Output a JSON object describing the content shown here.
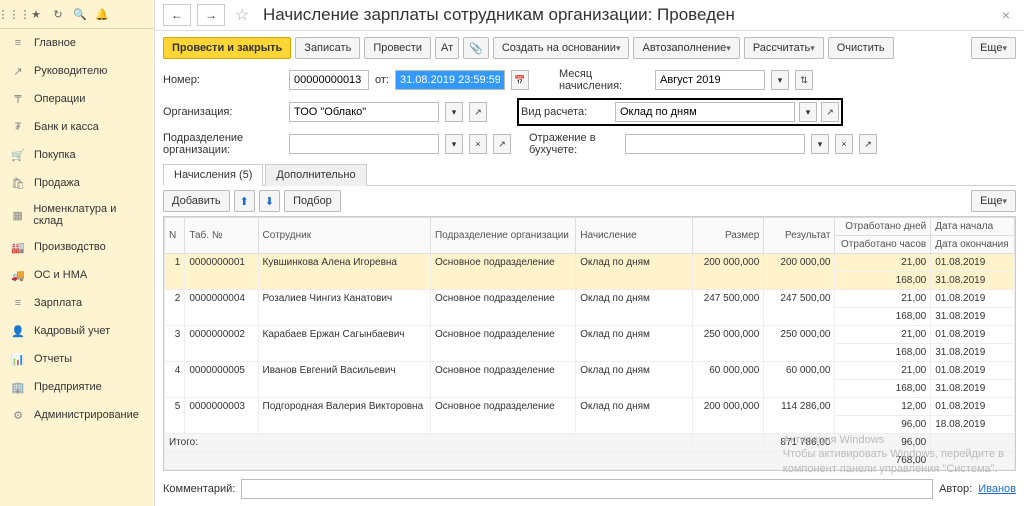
{
  "sidebar": {
    "items": [
      {
        "icon": "≡",
        "label": "Главное"
      },
      {
        "icon": "↗",
        "label": "Руководителю"
      },
      {
        "icon": "₸",
        "label": "Операции"
      },
      {
        "icon": "₮",
        "label": "Банк и касса"
      },
      {
        "icon": "🛒",
        "label": "Покупка"
      },
      {
        "icon": "🛍",
        "label": "Продажа"
      },
      {
        "icon": "▦",
        "label": "Номенклатура и склад"
      },
      {
        "icon": "🏭",
        "label": "Производство"
      },
      {
        "icon": "🚚",
        "label": "ОС и НМА"
      },
      {
        "icon": "≡",
        "label": "Зарплата"
      },
      {
        "icon": "👤",
        "label": "Кадровый учет"
      },
      {
        "icon": "📊",
        "label": "Отчеты"
      },
      {
        "icon": "🏢",
        "label": "Предприятие"
      },
      {
        "icon": "⚙",
        "label": "Администрирование"
      }
    ]
  },
  "header": {
    "title": "Начисление зарплаты сотрудникам организации: Проведен"
  },
  "toolbar": {
    "post_close": "Провести и закрыть",
    "write": "Записать",
    "post": "Провести",
    "create_based": "Создать на основании",
    "autofill": "Автозаполнение",
    "calc": "Рассчитать",
    "clear": "Очистить",
    "more": "Еще"
  },
  "form": {
    "number_lbl": "Номер:",
    "number": "00000000013",
    "from_lbl": "от:",
    "date": "31.08.2019 23:59:59",
    "month_lbl": "Месяц начисления:",
    "month": "Август 2019",
    "org_lbl": "Организация:",
    "org": "ТОО \"Облако\"",
    "calc_type_lbl": "Вид расчета:",
    "calc_type": "Оклад по дням",
    "dept_lbl": "Подразделение организации:",
    "dept": "",
    "acc_lbl": "Отражение в бухучете:",
    "acc": ""
  },
  "tabs": {
    "t1": "Начисления (5)",
    "t2": "Дополнительно"
  },
  "tbl_bar": {
    "add": "Добавить",
    "pick": "Подбор",
    "more": "Еще"
  },
  "cols": {
    "n": "N",
    "tab": "Таб. №",
    "emp": "Сотрудник",
    "dept": "Подразделение организации",
    "accr": "Начисление",
    "size": "Размер",
    "res": "Результат",
    "days": "Отработано дней",
    "hours": "Отработано часов",
    "dstart": "Дата начала",
    "dend": "Дата окончания"
  },
  "rows": [
    {
      "n": "1",
      "tab": "0000000001",
      "emp": "Кувшинкова Алена Игоревна",
      "dept": "Основное подразделение",
      "accr": "Оклад по дням",
      "size": "200 000,000",
      "res": "200 000,00",
      "days": "21,00",
      "hours": "168,00",
      "d1": "01.08.2019",
      "d2": "31.08.2019"
    },
    {
      "n": "2",
      "tab": "0000000004",
      "emp": "Розалиев Чингиз Канатович",
      "dept": "Основное подразделение",
      "accr": "Оклад по дням",
      "size": "247 500,000",
      "res": "247 500,00",
      "days": "21,00",
      "hours": "168,00",
      "d1": "01.08.2019",
      "d2": "31.08.2019"
    },
    {
      "n": "3",
      "tab": "0000000002",
      "emp": "Карабаев Ержан Сагынбаевич",
      "dept": "Основное подразделение",
      "accr": "Оклад по дням",
      "size": "250 000,000",
      "res": "250 000,00",
      "days": "21,00",
      "hours": "168,00",
      "d1": "01.08.2019",
      "d2": "31.08.2019"
    },
    {
      "n": "4",
      "tab": "0000000005",
      "emp": "Иванов Евгений Васильевич",
      "dept": "Основное подразделение",
      "accr": "Оклад по дням",
      "size": "60 000,000",
      "res": "60 000,00",
      "days": "21,00",
      "hours": "168,00",
      "d1": "01.08.2019",
      "d2": "31.08.2019"
    },
    {
      "n": "5",
      "tab": "0000000003",
      "emp": "Подгородная Валерия Викторовна",
      "dept": "Основное подразделение",
      "accr": "Оклад по дням",
      "size": "200 000,000",
      "res": "114 286,00",
      "days": "12,00",
      "hours": "96,00",
      "d1": "01.08.2019",
      "d2": "18.08.2019"
    }
  ],
  "totals": {
    "lbl": "Итого:",
    "res": "871 786,00",
    "days": "96,00",
    "hours": "768,00"
  },
  "comment": {
    "lbl": "Комментарий:",
    "val": "",
    "auth_lbl": "Автор:",
    "auth": "Иванов"
  },
  "watermark": {
    "l1": "Активация Windows",
    "l2": "Чтобы активировать Windows, перейдите в",
    "l3": "компонент панели управления \"Система\"."
  }
}
